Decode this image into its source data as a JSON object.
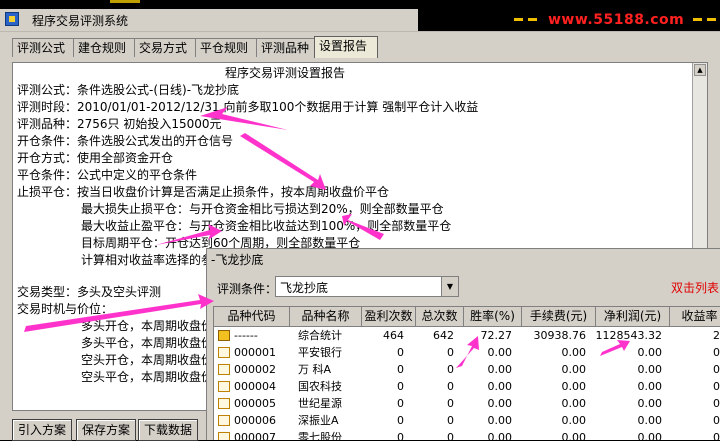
{
  "top_strip_text": "",
  "window": {
    "title": "程序交易评测系统",
    "promo": "www.55188.com"
  },
  "tabs": [
    {
      "label": "评测公式",
      "active": false
    },
    {
      "label": "建仓规则",
      "active": false
    },
    {
      "label": "交易方式",
      "active": false
    },
    {
      "label": "平仓规则",
      "active": false
    },
    {
      "label": "评测品种",
      "active": false
    },
    {
      "label": "设置报告",
      "active": true
    }
  ],
  "report": {
    "heading": "程序交易评测设置报告",
    "lines": [
      "评测公式：条件选股公式-(日线)-飞龙抄底",
      "评测时段：2010/01/01-2012/12/31  向前多取100个数据用于计算  强制平仓计入收益",
      "评测品种：2756只  初始投入15000元",
      "开仓条件：条件选股公式发出的开仓信号",
      "开仓方式：使用全部资金开仓",
      "平仓条件：公式中定义的平仓条件",
      "止损平仓：按当日收盘价计算是否满足止损条件，按本周期收盘价平仓",
      "最大损失止损平仓：与开仓资金相比亏损达到20%，则全部数量平仓",
      "最大收益止盈平仓：与开仓资金相比收益达到100%，则全部数量平仓",
      "目标周期平仓：开仓达到60个周期，则全部数量平仓",
      "计算相对收益率选择的参",
      "交易类型：多头及空头评测",
      "交易时机与价位：",
      "多头开仓，本周期收盘价",
      "多头平仓，本周期收盘价",
      "空头开仓，本周期收盘价",
      "空头平仓，本周期收盘价"
    ]
  },
  "buttons": {
    "import": "引入方案",
    "save": "保存方案",
    "download": "下载数据"
  },
  "popup": {
    "title": "-飞龙抄底",
    "condition_label": "评测条件：",
    "condition_value": "飞龙抄底",
    "link": "双击列表",
    "columns": [
      "品种代码",
      "品种名称",
      "盈利次数",
      "总次数",
      "胜率(%)",
      "手续费(元)",
      "净利润(元)",
      "收益率"
    ],
    "rows": [
      {
        "code": "------",
        "name": "综合统计",
        "wins": "464",
        "total": "642",
        "rate": "72.27",
        "fee": "30938.76",
        "profit": "1128543.32",
        "ret": "2"
      },
      {
        "code": "000001",
        "name": "平安银行",
        "wins": "0",
        "total": "0",
        "rate": "0.00",
        "fee": "0.00",
        "profit": "0.00",
        "ret": "0"
      },
      {
        "code": "000002",
        "name": "万  科A",
        "wins": "0",
        "total": "0",
        "rate": "0.00",
        "fee": "0.00",
        "profit": "0.00",
        "ret": "0"
      },
      {
        "code": "000004",
        "name": "国农科技",
        "wins": "0",
        "total": "0",
        "rate": "0.00",
        "fee": "0.00",
        "profit": "0.00",
        "ret": "0"
      },
      {
        "code": "000005",
        "name": "世纪星源",
        "wins": "0",
        "total": "0",
        "rate": "0.00",
        "fee": "0.00",
        "profit": "0.00",
        "ret": "0"
      },
      {
        "code": "000006",
        "name": "深振业A",
        "wins": "0",
        "total": "0",
        "rate": "0.00",
        "fee": "0.00",
        "profit": "0.00",
        "ret": "0"
      },
      {
        "code": "000007",
        "name": "零七股份",
        "wins": "0",
        "total": "0",
        "rate": "0.00",
        "fee": "0.00",
        "profit": "0.00",
        "ret": "0"
      }
    ]
  },
  "colors": {
    "annotation_arrow": "#ff33cc",
    "promo_text": "#ff2020",
    "link_text": "#e00000"
  }
}
